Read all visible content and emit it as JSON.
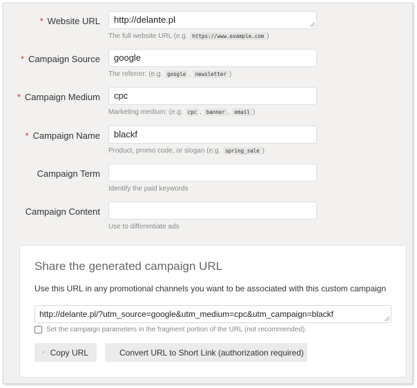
{
  "form": {
    "fields": [
      {
        "label": "Website URL",
        "required": true,
        "value": "http://delante.pl",
        "hint_prefix": "The full website URL (e.g.",
        "hint_codes": [
          "https://www.example.com"
        ],
        "hint_suffix": ")"
      },
      {
        "label": "Campaign Source",
        "required": true,
        "value": "google",
        "hint_prefix": "The referrer: (e.g.",
        "hint_codes": [
          "google",
          "newsletter"
        ],
        "hint_suffix": ")"
      },
      {
        "label": "Campaign Medium",
        "required": true,
        "value": "cpc",
        "hint_prefix": "Marketing medium: (e.g.",
        "hint_codes": [
          "cpc",
          "banner",
          "email"
        ],
        "hint_suffix": ")"
      },
      {
        "label": "Campaign Name",
        "required": true,
        "value": "blackf",
        "hint_prefix": "Product, promo code, or slogan (e.g.",
        "hint_codes": [
          "spring_sale"
        ],
        "hint_suffix": ")"
      },
      {
        "label": "Campaign Term",
        "required": false,
        "value": "",
        "hint_prefix": "Identify the paid keywords",
        "hint_codes": [],
        "hint_suffix": ""
      },
      {
        "label": "Campaign Content",
        "required": false,
        "value": "",
        "hint_prefix": "Use to differentiate ads",
        "hint_codes": [],
        "hint_suffix": ""
      }
    ],
    "required_mark": "*"
  },
  "share": {
    "title": "Share the generated campaign URL",
    "description": "Use this URL in any promotional channels you want to be associated with this custom campaign",
    "generated_url": "http://delante.pl/?utm_source=google&utm_medium=cpc&utm_campaign=blackf",
    "fragment_checkbox_label": "Set the campaign parameters in the fragment portion of the URL (not recommended).",
    "fragment_checked": false,
    "copy_button": "Copy URL",
    "short_link_button": "Convert URL to Short Link (authorization required)"
  }
}
